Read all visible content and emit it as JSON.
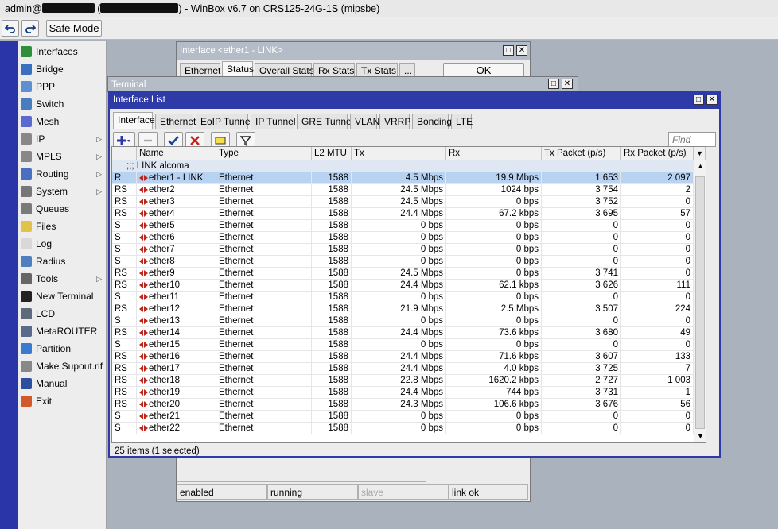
{
  "window": {
    "title_user": "admin@",
    "title_paren_open": "(",
    "title_paren_close": ")",
    "title_rest": "- WinBox v6.7 on CRS125-24G-1S (mipsbe)"
  },
  "toolbar": {
    "undo_icon": "undo-icon",
    "redo_icon": "redo-icon",
    "safe_mode_label": "Safe Mode"
  },
  "sidebar": {
    "items": [
      {
        "label": "Interfaces",
        "icon": "interfaces-icon",
        "submenu": false
      },
      {
        "label": "Bridge",
        "icon": "bridge-icon",
        "submenu": false
      },
      {
        "label": "PPP",
        "icon": "ppp-icon",
        "submenu": false
      },
      {
        "label": "Switch",
        "icon": "switch-icon",
        "submenu": false
      },
      {
        "label": "Mesh",
        "icon": "mesh-icon",
        "submenu": false
      },
      {
        "label": "IP",
        "icon": "ip-icon",
        "submenu": true
      },
      {
        "label": "MPLS",
        "icon": "mpls-icon",
        "submenu": true
      },
      {
        "label": "Routing",
        "icon": "routing-icon",
        "submenu": true
      },
      {
        "label": "System",
        "icon": "system-icon",
        "submenu": true
      },
      {
        "label": "Queues",
        "icon": "queues-icon",
        "submenu": false
      },
      {
        "label": "Files",
        "icon": "files-icon",
        "submenu": false
      },
      {
        "label": "Log",
        "icon": "log-icon",
        "submenu": false
      },
      {
        "label": "Radius",
        "icon": "radius-icon",
        "submenu": false
      },
      {
        "label": "Tools",
        "icon": "tools-icon",
        "submenu": true
      },
      {
        "label": "New Terminal",
        "icon": "terminal-icon",
        "submenu": false
      },
      {
        "label": "LCD",
        "icon": "lcd-icon",
        "submenu": false
      },
      {
        "label": "MetaROUTER",
        "icon": "metarouter-icon",
        "submenu": false
      },
      {
        "label": "Partition",
        "icon": "partition-icon",
        "submenu": false
      },
      {
        "label": "Make Supout.rif",
        "icon": "supout-icon",
        "submenu": false
      },
      {
        "label": "Manual",
        "icon": "manual-icon",
        "submenu": false
      },
      {
        "label": "Exit",
        "icon": "exit-icon",
        "submenu": false
      }
    ]
  },
  "ether_window": {
    "title": "Interface <ether1 - LINK>",
    "tabs": [
      "Ethernet",
      "Status",
      "Overall Stats",
      "Rx Stats",
      "Tx Stats",
      "..."
    ],
    "ok_label": "OK",
    "status_fields": [
      "enabled",
      "running",
      "slave",
      "link ok"
    ]
  },
  "terminal_window": {
    "title": "Terminal"
  },
  "interface_list": {
    "title": "Interface List",
    "tabs": [
      "Interface",
      "Ethernet",
      "EoIP Tunnel",
      "IP Tunnel",
      "GRE Tunnel",
      "VLAN",
      "VRRP",
      "Bonding",
      "LTE"
    ],
    "find_placeholder": "Find",
    "columns": [
      "Name",
      "Type",
      "L2 MTU",
      "Tx",
      "Rx",
      "Tx Packet (p/s)",
      "Rx Packet (p/s)"
    ],
    "comment": ";;; LINK alcoma",
    "rows": [
      {
        "flags": "R",
        "name": "ether1 - LINK",
        "type": "Ethernet",
        "mtu": "1588",
        "tx": "4.5 Mbps",
        "rx": "19.9 Mbps",
        "txp": "1 653",
        "rxp": "2 097"
      },
      {
        "flags": "RS",
        "name": "ether2",
        "type": "Ethernet",
        "mtu": "1588",
        "tx": "24.5 Mbps",
        "rx": "1024 bps",
        "txp": "3 754",
        "rxp": "2"
      },
      {
        "flags": "RS",
        "name": "ether3",
        "type": "Ethernet",
        "mtu": "1588",
        "tx": "24.5 Mbps",
        "rx": "0 bps",
        "txp": "3 752",
        "rxp": "0"
      },
      {
        "flags": "RS",
        "name": "ether4",
        "type": "Ethernet",
        "mtu": "1588",
        "tx": "24.4 Mbps",
        "rx": "67.2 kbps",
        "txp": "3 695",
        "rxp": "57"
      },
      {
        "flags": "S",
        "name": "ether5",
        "type": "Ethernet",
        "mtu": "1588",
        "tx": "0 bps",
        "rx": "0 bps",
        "txp": "0",
        "rxp": "0"
      },
      {
        "flags": "S",
        "name": "ether6",
        "type": "Ethernet",
        "mtu": "1588",
        "tx": "0 bps",
        "rx": "0 bps",
        "txp": "0",
        "rxp": "0"
      },
      {
        "flags": "S",
        "name": "ether7",
        "type": "Ethernet",
        "mtu": "1588",
        "tx": "0 bps",
        "rx": "0 bps",
        "txp": "0",
        "rxp": "0"
      },
      {
        "flags": "S",
        "name": "ether8",
        "type": "Ethernet",
        "mtu": "1588",
        "tx": "0 bps",
        "rx": "0 bps",
        "txp": "0",
        "rxp": "0"
      },
      {
        "flags": "RS",
        "name": "ether9",
        "type": "Ethernet",
        "mtu": "1588",
        "tx": "24.5 Mbps",
        "rx": "0 bps",
        "txp": "3 741",
        "rxp": "0"
      },
      {
        "flags": "RS",
        "name": "ether10",
        "type": "Ethernet",
        "mtu": "1588",
        "tx": "24.4 Mbps",
        "rx": "62.1 kbps",
        "txp": "3 626",
        "rxp": "111"
      },
      {
        "flags": "S",
        "name": "ether11",
        "type": "Ethernet",
        "mtu": "1588",
        "tx": "0 bps",
        "rx": "0 bps",
        "txp": "0",
        "rxp": "0"
      },
      {
        "flags": "RS",
        "name": "ether12",
        "type": "Ethernet",
        "mtu": "1588",
        "tx": "21.9 Mbps",
        "rx": "2.5 Mbps",
        "txp": "3 507",
        "rxp": "224"
      },
      {
        "flags": "S",
        "name": "ether13",
        "type": "Ethernet",
        "mtu": "1588",
        "tx": "0 bps",
        "rx": "0 bps",
        "txp": "0",
        "rxp": "0"
      },
      {
        "flags": "RS",
        "name": "ether14",
        "type": "Ethernet",
        "mtu": "1588",
        "tx": "24.4 Mbps",
        "rx": "73.6 kbps",
        "txp": "3 680",
        "rxp": "49"
      },
      {
        "flags": "S",
        "name": "ether15",
        "type": "Ethernet",
        "mtu": "1588",
        "tx": "0 bps",
        "rx": "0 bps",
        "txp": "0",
        "rxp": "0"
      },
      {
        "flags": "RS",
        "name": "ether16",
        "type": "Ethernet",
        "mtu": "1588",
        "tx": "24.4 Mbps",
        "rx": "71.6 kbps",
        "txp": "3 607",
        "rxp": "133"
      },
      {
        "flags": "RS",
        "name": "ether17",
        "type": "Ethernet",
        "mtu": "1588",
        "tx": "24.4 Mbps",
        "rx": "4.0 kbps",
        "txp": "3 725",
        "rxp": "7"
      },
      {
        "flags": "RS",
        "name": "ether18",
        "type": "Ethernet",
        "mtu": "1588",
        "tx": "22.8 Mbps",
        "rx": "1620.2 kbps",
        "txp": "2 727",
        "rxp": "1 003"
      },
      {
        "flags": "RS",
        "name": "ether19",
        "type": "Ethernet",
        "mtu": "1588",
        "tx": "24.4 Mbps",
        "rx": "744 bps",
        "txp": "3 731",
        "rxp": "1"
      },
      {
        "flags": "RS",
        "name": "ether20",
        "type": "Ethernet",
        "mtu": "1588",
        "tx": "24.3 Mbps",
        "rx": "106.6 kbps",
        "txp": "3 676",
        "rxp": "56"
      },
      {
        "flags": "S",
        "name": "ether21",
        "type": "Ethernet",
        "mtu": "1588",
        "tx": "0 bps",
        "rx": "0 bps",
        "txp": "0",
        "rxp": "0"
      },
      {
        "flags": "S",
        "name": "ether22",
        "type": "Ethernet",
        "mtu": "1588",
        "tx": "0 bps",
        "rx": "0 bps",
        "txp": "0",
        "rxp": "0"
      }
    ],
    "status_text": "25 items (1 selected)"
  },
  "colors": {
    "sidebar_stripe": "#2a36a8",
    "active_title": "#2e3aa8",
    "inactive_title": "#b4bcc8",
    "selected_row": "#b8d3f2"
  }
}
